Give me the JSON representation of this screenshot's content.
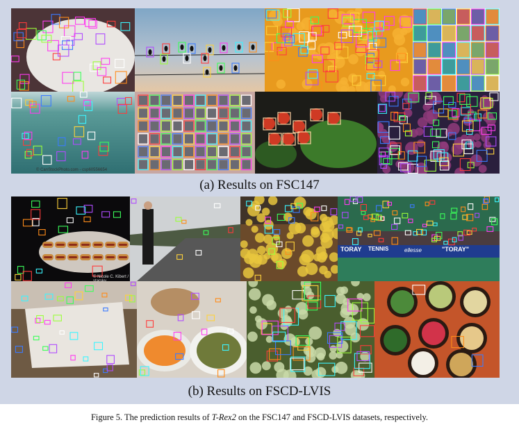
{
  "figure": {
    "section_a_caption": "(a) Results on FSC147",
    "section_b_caption": "(b) Results on FSCD-LVIS",
    "caption_label": "Figure 5.",
    "caption_pre": " The prediction results of ",
    "caption_model": "T-Rex2",
    "caption_post": " on the FSC147 and FSCD-LVIS datasets, respectively.",
    "watermark_a": "© CanStockPhoto.com - csp60556654",
    "watermark_b": "© Nicole C. Kibert / starsky",
    "banner_toray": "TORAY",
    "banner_tennis": "TENNIS",
    "banner_ellesse": "ellesse",
    "banner_toray2": "\"TORAY\""
  },
  "images_a": [
    {
      "name": "strawberries-plate",
      "desc": "strawberries"
    },
    {
      "name": "birds-on-wire",
      "desc": "birds"
    },
    {
      "name": "oranges",
      "desc": "oranges"
    },
    {
      "name": "book-covers",
      "desc": "books"
    },
    {
      "name": "boats-sea",
      "desc": "boats"
    },
    {
      "name": "building-windows",
      "desc": "windows"
    },
    {
      "name": "vegetables-herbs",
      "desc": "tomatoes"
    },
    {
      "name": "bottle-caps",
      "desc": "caps"
    }
  ],
  "images_b": [
    {
      "name": "hotdogs"
    },
    {
      "name": "road-cars"
    },
    {
      "name": "fruit-stand"
    },
    {
      "name": "tennis-stadium"
    },
    {
      "name": "food-tray"
    },
    {
      "name": "carrots-zucchini"
    },
    {
      "name": "vegetable-closeup"
    },
    {
      "name": "salad-plates"
    }
  ],
  "colors": {
    "panel_bg": "#cfd6e6",
    "box_palette": [
      "#ff3b3b",
      "#3bff5a",
      "#3b7bff",
      "#ffd23b",
      "#ff3bf0",
      "#3bf5ff",
      "#ff8c1a",
      "#b04bff",
      "#9cff3b",
      "#ffffff"
    ]
  }
}
